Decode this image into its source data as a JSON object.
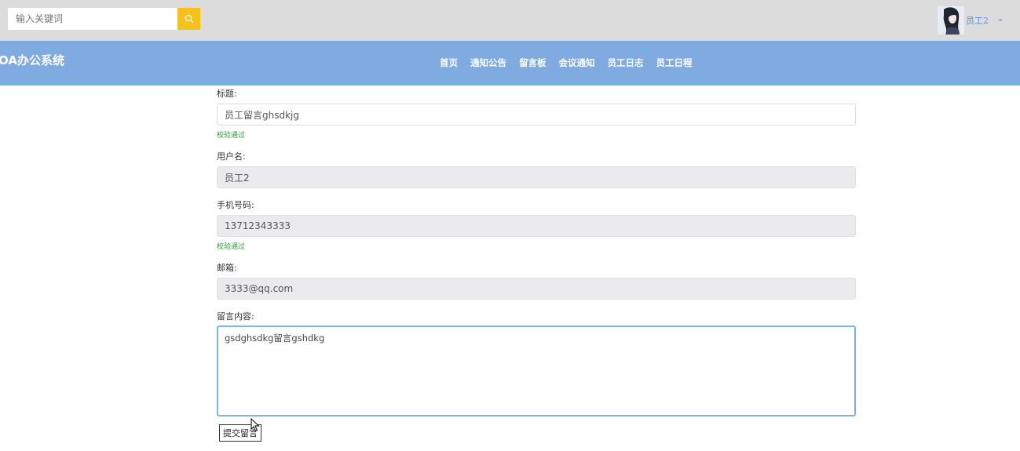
{
  "search": {
    "placeholder": "输入关键词",
    "icon": "search-icon"
  },
  "user": {
    "name": "员工2",
    "avatar_icon": "avatar-portrait-icon"
  },
  "brand": "OA办公系统",
  "nav": {
    "items": [
      "首页",
      "通知公告",
      "留言板",
      "会议通知",
      "员工日志",
      "员工日程"
    ]
  },
  "form": {
    "title_label": "标题:",
    "title_value": "员工留言ghsdkjg",
    "title_status": "校验通过",
    "username_label": "用户名:",
    "username_value": "员工2",
    "phone_label": "手机号码:",
    "phone_value": "13712343333",
    "phone_status": "校验通过",
    "email_label": "邮箱:",
    "email_value": "3333@qq.com",
    "content_label": "留言内容:",
    "content_value": "gsdghsdkg留言gshdkg",
    "submit_label": "提交留言"
  },
  "colors": {
    "topbar": "#dcdcdc",
    "navbar": "#7fabe1",
    "search_button": "#f5c21b",
    "valid": "#2e9a3b"
  }
}
